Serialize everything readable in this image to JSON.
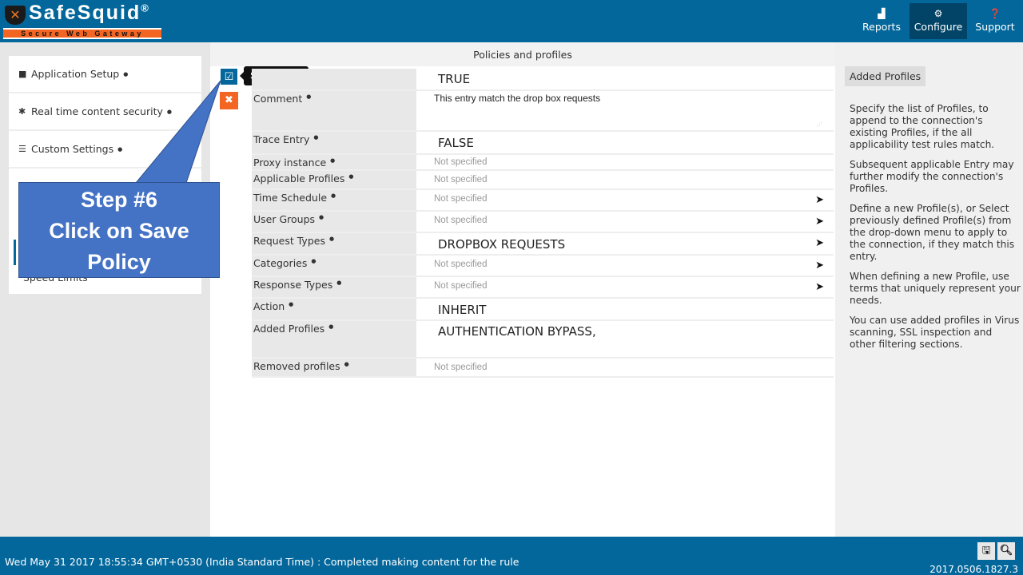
{
  "header": {
    "logo_title": "SafeSquid",
    "logo_reg": "®",
    "logo_subtitle": "Secure Web Gateway",
    "nav": [
      {
        "label": "Reports",
        "icon": "area-chart-icon"
      },
      {
        "label": "Configure",
        "icon": "cogs-icon",
        "active": true
      },
      {
        "label": "Support",
        "icon": "question-circle-icon"
      }
    ]
  },
  "sidebar": {
    "items": [
      {
        "label": "Application Setup",
        "icon": "briefcase-icon"
      },
      {
        "label": "Real time content security",
        "icon": "bug-icon"
      },
      {
        "label": "Custom Settings",
        "icon": "sliders-icon"
      }
    ],
    "partially_hidden_item": "Speed Limits"
  },
  "main": {
    "title": "Policies and profiles",
    "save_tooltip": "Save Policy",
    "rows": [
      {
        "label": "",
        "value": "TRUE",
        "style": "big"
      },
      {
        "label": "Comment",
        "value": "This entry match the drop box requests",
        "style": "comment"
      },
      {
        "label": "Trace Entry",
        "value": "FALSE",
        "style": "big"
      },
      {
        "label": "Proxy instance",
        "value": "Not specified"
      },
      {
        "label": "Applicable Profiles",
        "value": "Not specified"
      },
      {
        "label": "Time Schedule",
        "value": "Not specified",
        "action": true
      },
      {
        "label": "User Groups",
        "value": "Not specified",
        "action": true
      },
      {
        "label": "Request Types",
        "value": "DROPBOX REQUESTS",
        "style": "big",
        "action": true
      },
      {
        "label": "Categories",
        "value": "Not specified",
        "action": true
      },
      {
        "label": "Response Types",
        "value": "Not specified",
        "action": true
      },
      {
        "label": "Action",
        "value": "INHERIT",
        "style": "big"
      },
      {
        "label": "Added Profiles",
        "value": "AUTHENTICATION BYPASS,",
        "style": "big"
      },
      {
        "label": "Removed profiles",
        "value": "Not specified"
      }
    ]
  },
  "help": {
    "title": "Added Profiles",
    "paragraphs": [
      "Specify the list of Profiles, to append to the connection's existing Profiles, if the all applicability test rules match.",
      "Subsequent applicable Entry may further modify the connection's Profiles.",
      "Define a new Profile(s), or Select previously defined Profile(s) from the drop-down menu to apply to the connection, if they match this entry.",
      "When defining a new Profile, use terms that uniquely represent your needs.",
      "You can use added profiles in Virus scanning, SSL inspection and other filtering sections."
    ]
  },
  "footer": {
    "status": "Wed May 31 2017 18:55:34 GMT+0530 (India Standard Time) : Completed making content for the rule",
    "version": "2017.0506.1827.3"
  },
  "callout": {
    "line1": "Step #6",
    "line2": "Click on Save",
    "line3": "Policy",
    "color": "#4472c4"
  }
}
